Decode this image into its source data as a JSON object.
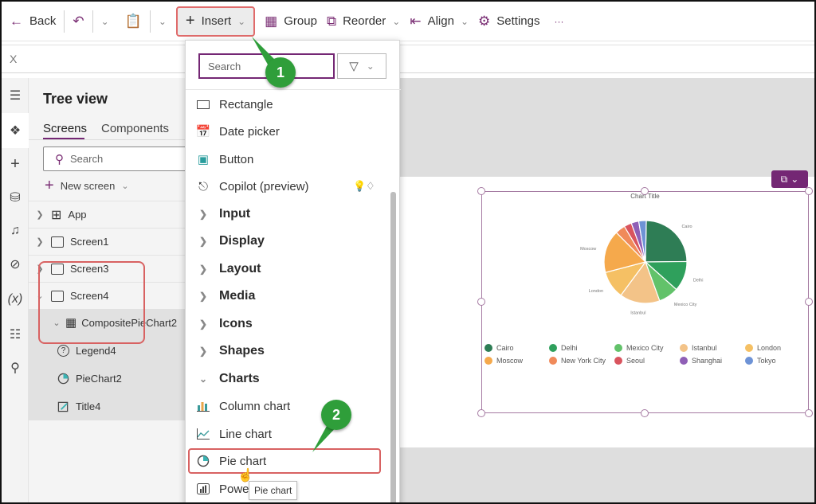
{
  "toolbar": {
    "back": "Back",
    "insert": "Insert",
    "group": "Group",
    "reorder": "Reorder",
    "align": "Align",
    "settings": "Settings",
    "more": "···"
  },
  "formula_bar": {
    "property": "X"
  },
  "tree_view": {
    "title": "Tree view",
    "tabs": [
      "Screens",
      "Components"
    ],
    "search_placeholder": "Search",
    "new_screen": "New screen",
    "items": [
      {
        "label": "App",
        "expanded": false
      },
      {
        "label": "Screen1",
        "expanded": false
      },
      {
        "label": "Screen3",
        "expanded": false
      },
      {
        "label": "Screen4",
        "expanded": true
      }
    ],
    "group": "CompositePieChart2",
    "children": [
      "Legend4",
      "PieChart2",
      "Title4"
    ]
  },
  "insert_menu": {
    "search_placeholder": "Search",
    "items": [
      {
        "label": "Rectangle",
        "icon": "rectangle-icon"
      },
      {
        "label": "Date picker",
        "icon": "calendar-icon"
      },
      {
        "label": "Button",
        "icon": "button-icon"
      },
      {
        "label": "Copilot (preview)",
        "icon": "copilot-icon"
      }
    ],
    "categories": [
      "Input",
      "Display",
      "Layout",
      "Media",
      "Icons",
      "Shapes",
      "Charts"
    ],
    "chart_items": [
      {
        "label": "Column chart",
        "icon": "column-chart-icon"
      },
      {
        "label": "Line chart",
        "icon": "line-chart-icon"
      },
      {
        "label": "Pie chart",
        "icon": "pie-chart-icon"
      },
      {
        "label": "Powe",
        "icon": "power-bi-icon"
      }
    ],
    "tooltip": "Pie chart"
  },
  "callouts": [
    "1",
    "2"
  ],
  "chart_data": {
    "type": "pie",
    "title": "Chart Title",
    "categories": [
      "Cairo",
      "Delhi",
      "Mexico City",
      "Istanbul",
      "London",
      "Moscow",
      "New York City",
      "Seoul",
      "Shanghai",
      "Tokyo"
    ],
    "values": [
      25,
      12,
      8,
      16,
      11,
      17,
      4,
      3,
      3,
      3
    ],
    "colors": [
      "#2e7d55",
      "#2fa05c",
      "#62c26a",
      "#f3c388",
      "#f5c064",
      "#f5a94c",
      "#f08a5a",
      "#d9545e",
      "#8f5fb6",
      "#6e93d6"
    ],
    "slice_labels": [
      "Cairo",
      "Delhi",
      "Mexico City",
      "Istanbul",
      "London",
      "Moscow"
    ],
    "legend": "bottom",
    "unit": "percent (estimated)"
  },
  "colors": {
    "accent": "#742774",
    "highlight": "#d86262",
    "callout": "#2f9e3a"
  }
}
